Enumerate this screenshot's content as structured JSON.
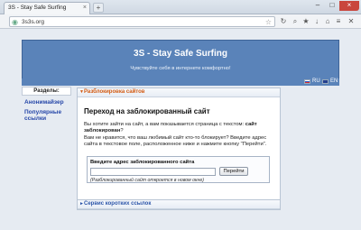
{
  "browser": {
    "tab_title": "3S - Stay Safe Surfing",
    "new_tab": "+",
    "url": "3s3s.org",
    "min": "–",
    "max": "□",
    "close": "×"
  },
  "site": {
    "title": "3S - Stay Safe Surfing",
    "subtitle": "Чувствуйте себя в интернете комфортно!",
    "lang_ru": "RU",
    "lang_en": "EN"
  },
  "sidebar": {
    "heading": "Разделы:",
    "links": [
      "Анонимайзер",
      "Популярные ссылки"
    ]
  },
  "main": {
    "panel_title": "Разблокировка сайтов",
    "content_title": "Переход на заблокированный сайт",
    "para1_a": "Вы хотите зайти на сайт, а вам показывается страница с текстом: ",
    "para1_b": "сайт заблокирован",
    "para1_c": "?",
    "para2": "Вам не нравится, что ваш любимый сайт кто-то блокирует? Введите адрес сайта в текстовое поле, расположенное ниже и нажмите кнопку \"Перейти\".",
    "form_label": "Введите адрес заблокированного сайта",
    "form_value": "",
    "button": "Перейти",
    "note": "(Разблокированный сайт откроется в новом окне)"
  },
  "bottom_panel": {
    "title": "Сервис коротких ссылок"
  }
}
